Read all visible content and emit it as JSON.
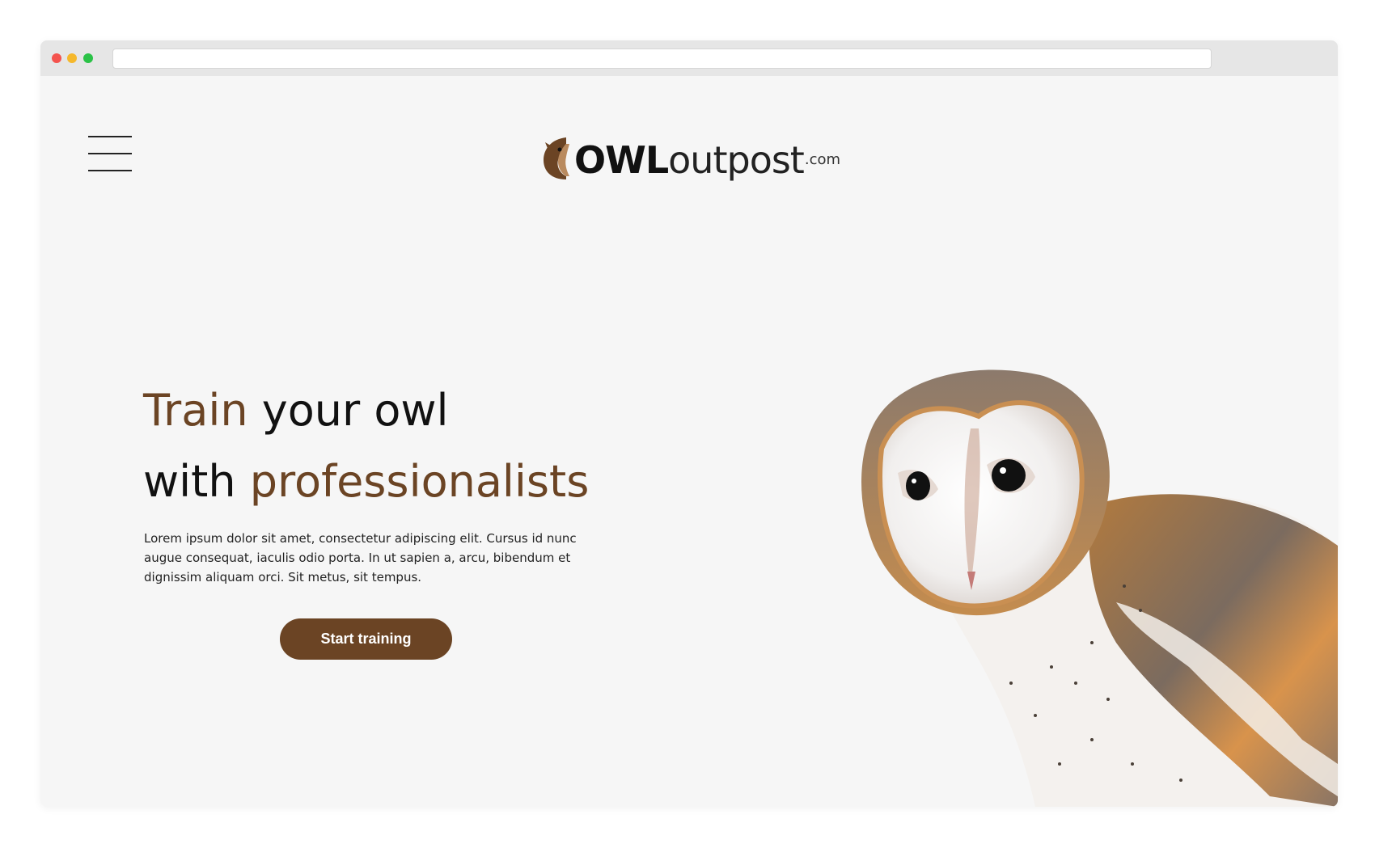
{
  "logo": {
    "owl": "OWL",
    "outpost": "outpost",
    "com": ".com"
  },
  "hero": {
    "title_line1_accent": "Train",
    "title_line1_rest": " your owl",
    "title_line2_plain": "with ",
    "title_line2_accent": "professionalists",
    "body": "Lorem ipsum dolor sit amet, consectetur adipiscing elit. Cursus id nunc augue consequat, iaculis odio porta. In ut sapien a, arcu, bibendum et dignissim aliquam orci. Sit metus, sit tempus.",
    "cta_label": "Start training"
  },
  "colors": {
    "accent": "#6b4424",
    "background": "#f6f6f6",
    "text": "#111111"
  },
  "icons": {
    "menu": "hamburger-menu-icon",
    "logo_mark": "owl-head-icon"
  }
}
